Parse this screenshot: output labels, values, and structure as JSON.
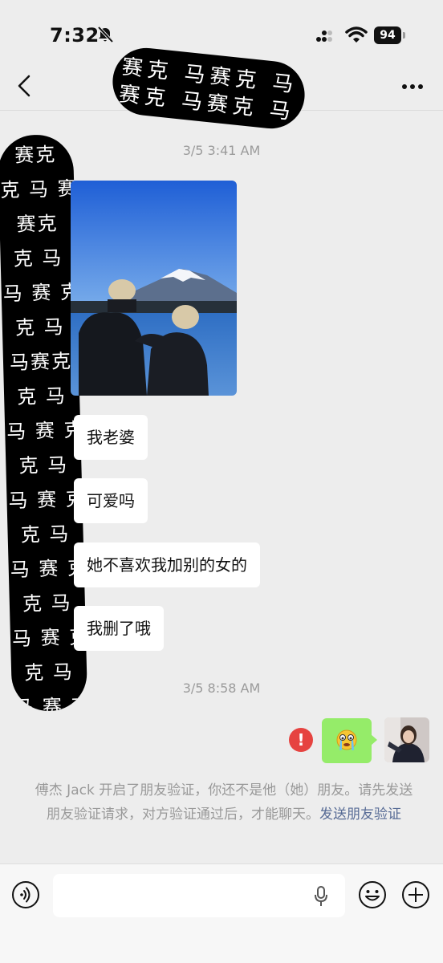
{
  "status_bar": {
    "time": "7:32",
    "battery": "94"
  },
  "nav": {
    "title_redaction": "赛克 马赛克 马\n赛克 马赛克 马"
  },
  "avatar_redaction": "赛克\n克 马 赛\n赛克\n克 马\n马 赛 克\n克 马\n马赛克\n克 马\n马 赛 克\n克 马\n马 赛 克\n克 马\n马 赛 克\n克 马\n马 赛 克\n克 马\n马 赛 克\n马\n马 赛 克\n克 马\n赛 克",
  "chat": {
    "timestamp_1": "3/5 3:41 AM",
    "messages": [
      {
        "text": "我老婆"
      },
      {
        "text": "可爱吗"
      },
      {
        "text": "她不喜欢我加别的女的"
      },
      {
        "text": "我删了哦"
      }
    ],
    "timestamp_2": "3/5 8:58 AM",
    "error_mark": "!",
    "notice_text": "傅杰 Jack 开启了朋友验证，你还不是他（她）朋友。请先发送朋友验证请求，对方验证通过后，才能聊天。",
    "notice_link": "发送朋友验证"
  },
  "icons": {
    "back": "chevron-left-icon",
    "more": "more-dots-icon",
    "voice": "voice-icon",
    "mic": "microphone-icon",
    "emoji": "emoji-icon",
    "plus": "plus-icon",
    "error": "error-icon"
  },
  "colors": {
    "background": "#ededed",
    "my_bubble": "#95ec69",
    "link": "#576b95",
    "error": "#e64340"
  }
}
